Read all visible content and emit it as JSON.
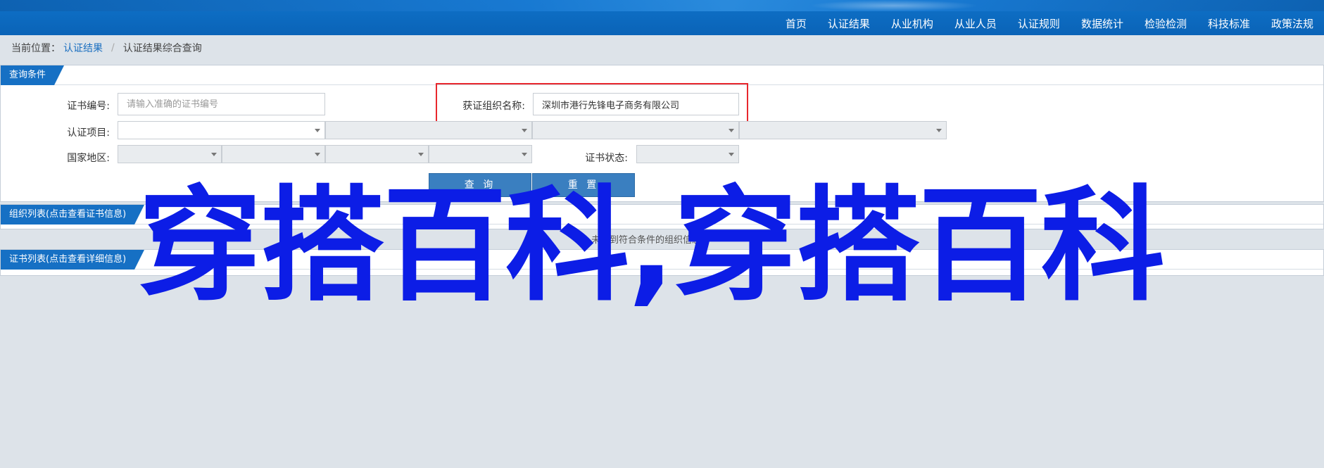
{
  "nav": {
    "items": [
      "首页",
      "认证结果",
      "从业机构",
      "从业人员",
      "认证规则",
      "数据统计",
      "检验检测",
      "科技标准",
      "政策法规"
    ]
  },
  "breadcrumb": {
    "prefix": "当前位置：",
    "link": "认证结果",
    "current": "认证结果综合查询"
  },
  "query_panel": {
    "title": "查询条件",
    "cert_no_label": "证书编号:",
    "cert_no_placeholder": "请输入准确的证书编号",
    "org_name_label": "获证组织名称:",
    "org_name_value": "深圳市港行先锋电子商务有限公司",
    "cert_project_label": "认证项目:",
    "region_label": "国家地区:",
    "cert_status_label": "证书状态:",
    "search_button": "查 询",
    "reset_button": "重 置"
  },
  "org_panel": {
    "title": "组织列表(点击查看证书信息)",
    "empty_text": "未查到符合条件的组织信息"
  },
  "cert_panel": {
    "title": "证书列表(点击查看详细信息)"
  },
  "watermark": {
    "text": "穿搭百科,穿搭百科"
  },
  "colors": {
    "brand_blue": "#1670c4",
    "highlight_red": "#e8272d",
    "watermark_blue": "#0c1de6"
  }
}
